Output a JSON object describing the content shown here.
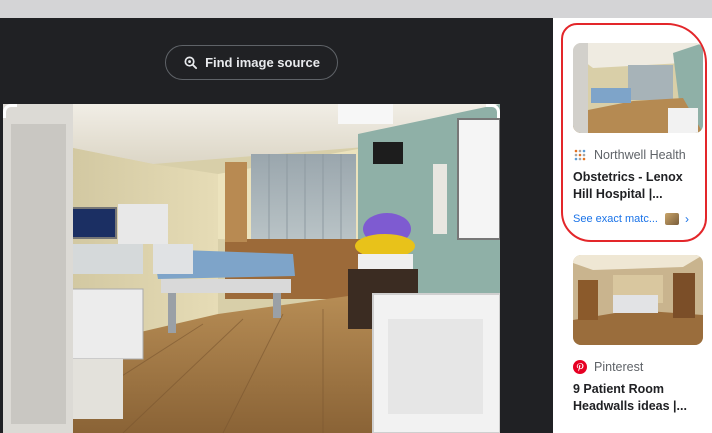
{
  "find_button": {
    "label": "Find image source",
    "icon": "lens-search-icon"
  },
  "results": [
    {
      "source_name": "Northwell Health",
      "favicon": "northwell-dots-icon",
      "title": "Obstetrics - Lenox Hill Hospital |...",
      "exact_match": "See exact matc..."
    },
    {
      "source_name": "Pinterest",
      "favicon": "pinterest-icon",
      "title": "9 Patient Room Headwalls ideas |..."
    }
  ],
  "colors": {
    "background": "#202124",
    "panel": "#ffffff",
    "link": "#1a73e8",
    "annotation": "#e3262a"
  }
}
